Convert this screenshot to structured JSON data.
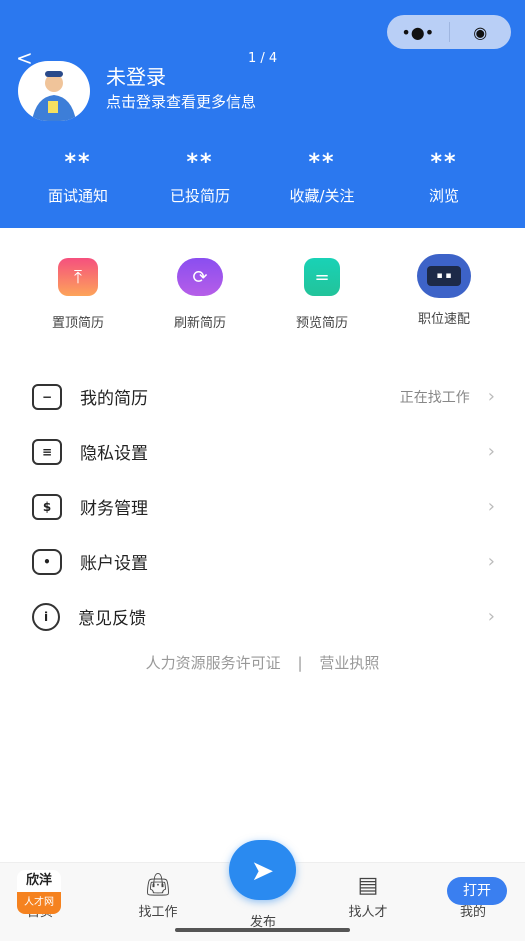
{
  "header": {
    "back_icon": "chevron-left-icon",
    "pager": "1 / 4",
    "name": "未登录",
    "subtitle": "点击登录查看更多信息",
    "capsule": {
      "more_icon": "more-dots-icon",
      "close_icon": "target-circle-icon"
    }
  },
  "stats": [
    {
      "value": "**",
      "label": "面试通知"
    },
    {
      "value": "**",
      "label": "已投简历"
    },
    {
      "value": "**",
      "label": "收藏/关注"
    },
    {
      "value": "**",
      "label": "浏览"
    }
  ],
  "quick_actions": [
    {
      "label": "置顶简历",
      "icon": "pin-top-icon",
      "color": "#f5647a"
    },
    {
      "label": "刷新简历",
      "icon": "refresh-icon",
      "color": "#8a4ef0"
    },
    {
      "label": "预览简历",
      "icon": "document-icon",
      "color": "#1ec9a8"
    },
    {
      "label": "职位速配",
      "icon": "robot-icon",
      "color": "#3d63c8"
    }
  ],
  "menu": [
    {
      "label": "我的简历",
      "status": "正在找工作",
      "icon": "folder-icon"
    },
    {
      "label": "隐私设置",
      "icon": "privacy-lock-icon"
    },
    {
      "label": "财务管理",
      "icon": "wallet-icon"
    },
    {
      "label": "账户设置",
      "icon": "hexagon-settings-icon"
    },
    {
      "label": "意见反馈",
      "icon": "info-icon"
    }
  ],
  "footer_links": {
    "license": "人力资源服务许可证",
    "separator": "|",
    "business": "营业执照"
  },
  "tabbar": {
    "home": "首页",
    "jobs": "找工作",
    "publish": "发布",
    "talent": "找人才",
    "mine": "我的",
    "logo_top": "欣洋",
    "logo_bottom": "人才网",
    "open": "打开"
  },
  "colors": {
    "brand": "#2b78ef"
  }
}
